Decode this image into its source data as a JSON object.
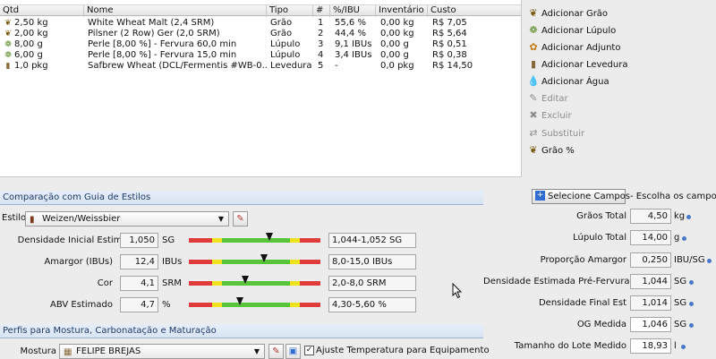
{
  "colors": {
    "accent": "#2f6bd3",
    "bar_red": "#e23b3b",
    "bar_yellow": "#f1e21c",
    "bar_green": "#58c43a"
  },
  "table": {
    "headers": [
      "Qtd",
      "Nome",
      "Tipo",
      "#",
      "%/IBU",
      "Inventário",
      "Custo"
    ],
    "rows": [
      {
        "icon": "grain-icon",
        "qtd": "2,50 kg",
        "nome": "White Wheat Malt (2,4 SRM)",
        "tipo": "Grão",
        "num": "1",
        "ibu": "55,6 %",
        "inv": "0,00 kg",
        "custo": "R$ 7,05"
      },
      {
        "icon": "grain-icon",
        "qtd": "2,00 kg",
        "nome": "Pilsner (2 Row) Ger (2,0 SRM)",
        "tipo": "Grão",
        "num": "2",
        "ibu": "44,4 %",
        "inv": "0,00 kg",
        "custo": "R$ 5,64"
      },
      {
        "icon": "hop-icon",
        "qtd": "8,00 g",
        "nome": "Perle [8,00 %] - Fervura 60,0 min",
        "tipo": "Lúpulo",
        "num": "3",
        "ibu": "9,1 IBUs",
        "inv": "0,00 g",
        "custo": "R$ 0,51"
      },
      {
        "icon": "hop-icon",
        "qtd": "6,00 g",
        "nome": "Perle [8,00 %] - Fervura 15,0 min",
        "tipo": "Lúpulo",
        "num": "4",
        "ibu": "3,4 IBUs",
        "inv": "0,00 g",
        "custo": "R$ 0,38"
      },
      {
        "icon": "yeast-icon",
        "qtd": "1,0 pkg",
        "nome": "Safbrew Wheat (DCL/Fermentis #WB-0...",
        "tipo": "Levedura",
        "num": "5",
        "ibu": "-",
        "inv": "0,0 pkg",
        "custo": "R$ 14,50"
      }
    ]
  },
  "actions": [
    {
      "label": "Adicionar Grão",
      "icon": "grain-icon",
      "glyph": "❦",
      "enabled": true
    },
    {
      "label": "Adicionar Lúpulo",
      "icon": "hop-icon",
      "glyph": "❁",
      "enabled": true
    },
    {
      "label": "Adicionar Adjunto",
      "icon": "adjunct-icon",
      "glyph": "✿",
      "enabled": true
    },
    {
      "label": "Adicionar Levedura",
      "icon": "yeast-icon",
      "glyph": "▮",
      "enabled": true
    },
    {
      "label": "Adicionar Água",
      "icon": "water-drop-icon",
      "glyph": "💧",
      "enabled": true
    },
    {
      "label": "Editar",
      "icon": "edit-icon",
      "glyph": "✎",
      "enabled": false
    },
    {
      "label": "Excluir",
      "icon": "delete-icon",
      "glyph": "✖",
      "enabled": false
    },
    {
      "label": "Substituir",
      "icon": "replace-icon",
      "glyph": "⇄",
      "enabled": false
    },
    {
      "label": "Grão %",
      "icon": "grain-percent-icon",
      "glyph": "❦",
      "enabled": true
    }
  ],
  "style_section": {
    "title": "Comparação com Guia de Estilos",
    "style_label": "Estilo",
    "style_value": "Weizen/Weissbier",
    "metrics": [
      {
        "label": "Densidade Inicial Estimada",
        "value": "1,050",
        "unit": "SG",
        "range": "1,044-1,052 SG",
        "position": 0.61
      },
      {
        "label": "Amargor (IBUs)",
        "value": "12,4",
        "unit": "IBUs",
        "range": "8,0-15,0 IBUs",
        "position": 0.57
      },
      {
        "label": "Cor",
        "value": "4,1",
        "unit": "SRM",
        "range": "2,0-8,0 SRM",
        "position": 0.43
      },
      {
        "label": "ABV Estimado",
        "value": "4,7",
        "unit": "%",
        "range": "4,30-5,60 %",
        "position": 0.39
      }
    ]
  },
  "mash_section": {
    "title": "Perfis para Mostura, Carbonatação e Maturação",
    "mash_label": "Mostura",
    "mash_value": "FELIPE BREJAS",
    "adjust_label": "Ajuste Temperatura para Equipamento",
    "adjust_checked": true
  },
  "fields_panel": {
    "button_label": "Selecione Campos",
    "hint": "- Escolha os campos",
    "fields": [
      {
        "label": "Grãos Total",
        "value": "4,50",
        "unit": "kg",
        "editable": false
      },
      {
        "label": "Lúpulo Total",
        "value": "14,00",
        "unit": "g",
        "editable": false
      },
      {
        "label": "Proporção Amargor",
        "value": "0,250",
        "unit": "IBU/SG",
        "editable": false
      },
      {
        "label": "Densidade Estimada Pré-Fervura",
        "value": "1,044",
        "unit": "SG",
        "editable": false
      },
      {
        "label": "Densidade Final Est",
        "value": "1,014",
        "unit": "SG",
        "editable": false
      },
      {
        "label": "OG Medida",
        "value": "1,046",
        "unit": "SG",
        "editable": true
      },
      {
        "label": "Tamanho do Lote Medido",
        "value": "18,93",
        "unit": "l",
        "editable": true
      }
    ]
  }
}
